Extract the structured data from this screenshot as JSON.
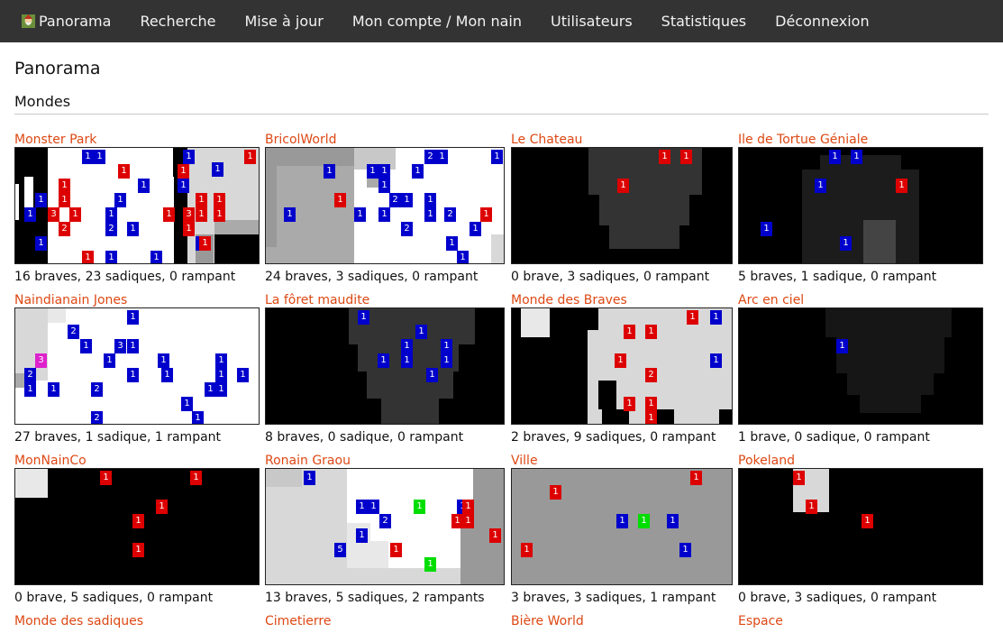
{
  "nav": {
    "items": [
      {
        "label": "Panorama",
        "name": "nav-panorama",
        "icon": "dwarf-logo-icon"
      },
      {
        "label": "Recherche",
        "name": "nav-recherche"
      },
      {
        "label": "Mise à jour",
        "name": "nav-mise-a-jour"
      },
      {
        "label": "Mon compte / Mon nain",
        "name": "nav-mon-compte"
      },
      {
        "label": "Utilisateurs",
        "name": "nav-utilisateurs"
      },
      {
        "label": "Statistiques",
        "name": "nav-statistiques"
      },
      {
        "label": "Déconnexion",
        "name": "nav-deconnexion"
      }
    ]
  },
  "page": {
    "title": "Panorama",
    "section": "Mondes"
  },
  "colors": {
    "nav_bg": "#333333",
    "link": "#dd4814",
    "brave": "#0000cc",
    "sadique": "#dd0000",
    "rampant": "#dd22cc",
    "green": "#00dd00"
  },
  "worlds": [
    {
      "name": "Monster Park",
      "stats": "16 braves, 23 sadiques, 0 rampant"
    },
    {
      "name": "BricolWorld",
      "stats": "24 braves, 3 sadiques, 0 rampant"
    },
    {
      "name": "Le Chateau",
      "stats": "0 brave, 3 sadiques, 0 rampant"
    },
    {
      "name": "Ile de Tortue Géniale",
      "stats": "5 braves, 1 sadique, 0 rampant"
    },
    {
      "name": "Naindianain Jones",
      "stats": "27 braves, 1 sadique, 1 rampant"
    },
    {
      "name": "La fôret maudite",
      "stats": "8 braves, 0 sadique, 0 rampant"
    },
    {
      "name": "Monde des Braves",
      "stats": "2 braves, 9 sadiques, 0 rampant"
    },
    {
      "name": "Arc en ciel",
      "stats": "1 brave, 0 sadique, 0 rampant"
    },
    {
      "name": "MonNainCo",
      "stats": "0 brave, 5 sadiques, 0 rampant"
    },
    {
      "name": "Ronain Graou",
      "stats": "13 braves, 5 sadiques, 2 rampants"
    },
    {
      "name": "Ville",
      "stats": "3 braves, 3 sadiques, 1 rampant"
    },
    {
      "name": "Pokeland",
      "stats": "0 brave, 3 sadiques, 0 rampant"
    },
    {
      "name": "Monde des sadiques",
      "stats": ""
    },
    {
      "name": "Cimetierre",
      "stats": ""
    },
    {
      "name": "Bière World",
      "stats": ""
    },
    {
      "name": "Espace",
      "stats": ""
    }
  ],
  "markers": [
    [
      [
        "b",
        "1"
      ],
      [
        "b",
        "1"
      ],
      [
        "b",
        "1"
      ],
      [
        "r",
        "1"
      ],
      [
        "r",
        "1"
      ],
      [
        "b",
        "1"
      ],
      [
        "r",
        "1"
      ],
      [
        "b",
        "1"
      ],
      [
        "r",
        "1"
      ],
      [
        "b",
        "1"
      ],
      [
        "b",
        "1"
      ],
      [
        "r",
        "1"
      ],
      [
        "r",
        "1"
      ],
      [
        "r",
        "1"
      ],
      [
        "b",
        "1"
      ],
      [
        "r",
        "1"
      ],
      [
        "b",
        "1"
      ],
      [
        "r",
        "1"
      ],
      [
        "r",
        "3"
      ],
      [
        "r",
        "1"
      ],
      [
        "b",
        "1"
      ],
      [
        "r",
        "1"
      ],
      [
        "r",
        "3"
      ],
      [
        "r",
        "1"
      ],
      [
        "r",
        "2"
      ],
      [
        "b",
        "2"
      ],
      [
        "b",
        "1"
      ],
      [
        "r",
        "1"
      ],
      [
        "b",
        "1"
      ],
      [
        "b",
        "1"
      ],
      [
        "b",
        "1"
      ],
      [
        "r",
        "1"
      ],
      [
        "b",
        "1"
      ],
      [
        "r",
        "1"
      ]
    ],
    [
      [
        "b",
        "2"
      ],
      [
        "b",
        "1"
      ],
      [
        "b",
        "1"
      ],
      [
        "b",
        "1"
      ],
      [
        "b",
        "1"
      ],
      [
        "b",
        "1"
      ],
      [
        "b",
        "1"
      ],
      [
        "b",
        "1"
      ],
      [
        "r",
        "1"
      ],
      [
        "b",
        "2"
      ],
      [
        "b",
        "1"
      ],
      [
        "b",
        "1"
      ],
      [
        "b",
        "1"
      ],
      [
        "b",
        "1"
      ],
      [
        "b",
        "1"
      ],
      [
        "b",
        "1"
      ],
      [
        "b",
        "2"
      ],
      [
        "r",
        "1"
      ],
      [
        "b",
        "2"
      ],
      [
        "b",
        "1"
      ],
      [
        "b",
        "1"
      ],
      [
        "b",
        "1"
      ]
    ],
    [
      [
        "r",
        "1"
      ],
      [
        "r",
        "1"
      ],
      [
        "r",
        "1"
      ]
    ],
    [
      [
        "b",
        "1"
      ],
      [
        "b",
        "1"
      ],
      [
        "b",
        "1"
      ],
      [
        "r",
        "1"
      ],
      [
        "b",
        "1"
      ],
      [
        "b",
        "1"
      ]
    ],
    [
      [
        "b",
        "1"
      ],
      [
        "b",
        "2"
      ],
      [
        "b",
        "1"
      ],
      [
        "b",
        "3"
      ],
      [
        "b",
        "1"
      ],
      [
        "m",
        "3"
      ],
      [
        "b",
        "1"
      ],
      [
        "b",
        "1"
      ],
      [
        "b",
        "1"
      ],
      [
        "b",
        "2"
      ],
      [
        "b",
        "1"
      ],
      [
        "b",
        "1"
      ],
      [
        "b",
        "1"
      ],
      [
        "b",
        "1"
      ],
      [
        "b",
        "1"
      ],
      [
        "b",
        "1"
      ],
      [
        "b",
        "2"
      ],
      [
        "b",
        "1"
      ],
      [
        "b",
        "1"
      ],
      [
        "b",
        "1"
      ],
      [
        "b",
        "2"
      ],
      [
        "b",
        "1"
      ],
      [
        "b",
        "1"
      ]
    ],
    [
      [
        "b",
        "1"
      ],
      [
        "b",
        "1"
      ],
      [
        "b",
        "1"
      ],
      [
        "b",
        "1"
      ],
      [
        "b",
        "1"
      ],
      [
        "b",
        "1"
      ],
      [
        "b",
        "1"
      ],
      [
        "b",
        "1"
      ]
    ],
    [
      [
        "r",
        "1"
      ],
      [
        "b",
        "1"
      ],
      [
        "r",
        "1"
      ],
      [
        "r",
        "1"
      ],
      [
        "r",
        "1"
      ],
      [
        "b",
        "1"
      ],
      [
        "r",
        "2"
      ],
      [
        "r",
        "1"
      ],
      [
        "r",
        "1"
      ],
      [
        "r",
        "1"
      ]
    ],
    [
      [
        "b",
        "1"
      ]
    ],
    [
      [
        "r",
        "1"
      ],
      [
        "r",
        "1"
      ],
      [
        "r",
        "1"
      ],
      [
        "r",
        "1"
      ],
      [
        "r",
        "1"
      ]
    ],
    [
      [
        "b",
        "1"
      ],
      [
        "b",
        "1"
      ],
      [
        "b",
        "1"
      ],
      [
        "b",
        "1"
      ],
      [
        "g",
        "1"
      ],
      [
        "r",
        "1"
      ],
      [
        "b",
        "2"
      ],
      [
        "r",
        "1"
      ],
      [
        "r",
        "1"
      ],
      [
        "r",
        "1"
      ],
      [
        "b",
        "1"
      ],
      [
        "b",
        "5"
      ],
      [
        "r",
        "1"
      ],
      [
        "g",
        "1"
      ]
    ],
    [
      [
        "r",
        "1"
      ],
      [
        "r",
        "1"
      ],
      [
        "b",
        "1"
      ],
      [
        "g",
        "1"
      ],
      [
        "b",
        "1"
      ],
      [
        "r",
        "1"
      ],
      [
        "b",
        "1"
      ]
    ],
    [
      [
        "r",
        "1"
      ],
      [
        "r",
        "1"
      ],
      [
        "r",
        "1"
      ]
    ]
  ]
}
